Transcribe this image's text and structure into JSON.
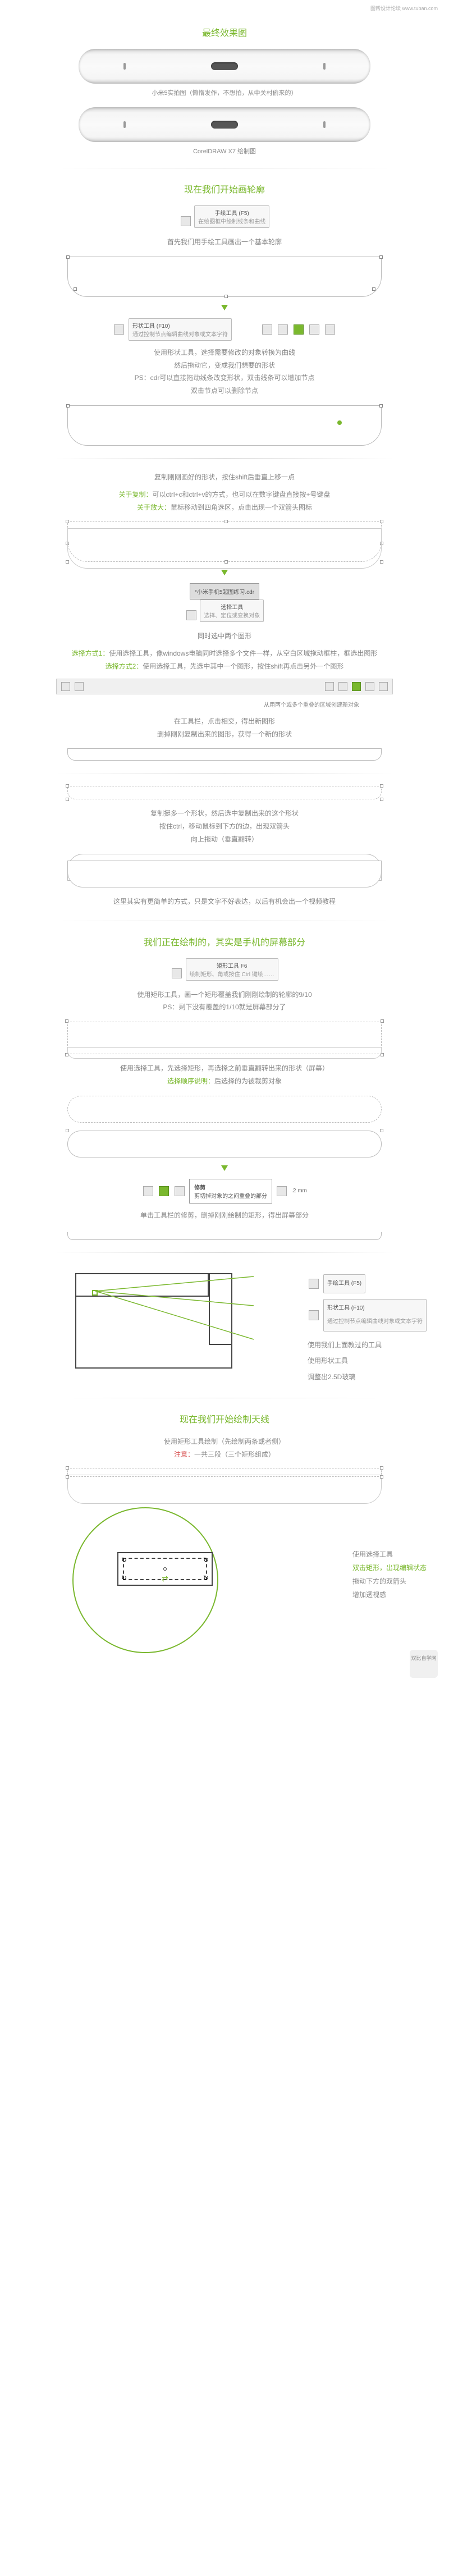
{
  "top_label": "图帮设计论坛 www.tuban.com",
  "sec1_title": "最终效果图",
  "render1_caption": "小米5实拍图（懒惰发作，不想拍，从中关村偷来的）",
  "render2_caption": "CorelDRAW X7 绘制图",
  "sec2_title": "现在我们开始画轮廓",
  "tool_hand_label": "手绘工具 (F5)",
  "tool_hand_hint": "在绘图框中绘制线条和曲线",
  "sec2_instr1": "首先我们用手绘工具画出一个基本轮廓",
  "tool_shape_label": "形状工具 (F10)",
  "tool_shape_hint": "通过控制节点编辑曲线对象或文本字符",
  "sec2_instr2a": "使用形状工具，选择需要修改的对象转换为曲线",
  "sec2_instr2b": "然后拖动它，变成我们想要的形状",
  "sec2_instr2c": "PS：cdr可以直接拖动线条改变形状，双击线条可以增加节点",
  "sec2_instr2d": "双击节点可以删除节点",
  "sec3_instr1": "复制刚刚画好的形状，按住shift后垂直上移一点",
  "sec3_copy_lbl": "关于复制：",
  "sec3_copy_txt": "可以ctrl+c和ctrl+v的方式，也可以在数字键盘直接按+号键盘",
  "sec3_zoom_lbl": "关于放大：",
  "sec3_zoom_txt": "鼠标移动到四角选区，点击出现一个双箭头图标",
  "tool_file_label": "*小米手机5起图练习.cdr",
  "tool_select_label": "选择工具",
  "tool_select_hint": "选择、定位或变换对象",
  "sec4_instr1": "同时选中两个图形",
  "sec4_sel1_lbl": "选择方式1：",
  "sec4_sel1_txt": "使用选择工具，像windows电脑同时选择多个文件一样，从空白区域拖动框柱，框选出图形",
  "sec4_sel2_lbl": "选择方式2：",
  "sec4_sel2_txt": "使用选择工具，先选中其中一个图形，按住shift再点击另外一个图形",
  "toolbar_hint": "从用两个或多个重叠的区域创建新对象",
  "sec4_instr2a": "在工具栏，点击相交，得出新图形",
  "sec4_instr2b": "删掉刚刚复制出来的图形，获得一个新的形状",
  "sec5_instr1": "复制挺多一个形状，然后选中复制出来的这个形状",
  "sec5_instr2": "按住ctrl，移动鼠标到下方的边，出现双箭头",
  "sec5_instr3": "向上拖动（垂直翻转）",
  "sec5_instr4": "这里其实有更简单的方式，只是文字不好表达，以后有机会出一个视频教程",
  "sec6_title": "我们正在绘制的，其实是手机的屏幕部分",
  "tool_rect_label": "矩形工具 F6",
  "tool_rect_hint": "绘制矩形、角或按住 Ctrl 键绘……",
  "sec6_instr1": "使用矩形工具，画一个矩形覆盖我们刚刚绘制的轮廓的9/10",
  "sec6_instr2": "PS：剩下没有覆盖的1/10就是屏幕部分了",
  "sec6_instr3a": "使用选择工具，先选择矩形，再选择之前垂直翻转出来的形状（屏幕）",
  "sec6_instr3b_lbl": "选择顺序说明：",
  "sec6_instr3b_txt": "后选择的为被裁剪对象",
  "tool_trim_label": "修剪",
  "tool_trim_hint": "剪切掉对象的之间重叠的部分",
  "tool_trim_val": ".2 mm",
  "sec6_instr4": "单击工具栏的修剪，删掉刚刚绘制的矩形，得出屏幕部分",
  "sec7_hand_label": "手绘工具 (F5)",
  "sec7_shape_label": "形状工具 (F10)",
  "sec7_shape_hint": "通过控制节点编辑曲线对象或文本字符",
  "sec7_instr1": "使用我们上面教过的工具",
  "sec7_instr2": "使用形状工具",
  "sec7_instr3": "调整出2.5D玻璃",
  "sec8_title": "现在我们开始绘制天线",
  "sec8_instr1": "使用矩形工具绘制（先绘制两条或者侧）",
  "sec8_instr2a_lbl": "注意：",
  "sec8_instr2a_txt": "一共三段（三个矩形组成）",
  "sec8_instr3": "使用选择工具",
  "sec8_instr4a": "双击矩形，出现编辑状态",
  "sec8_instr4b": "拖动下方的双箭头",
  "sec8_instr4c": "增加透视感",
  "footer_text": "双比自学网"
}
